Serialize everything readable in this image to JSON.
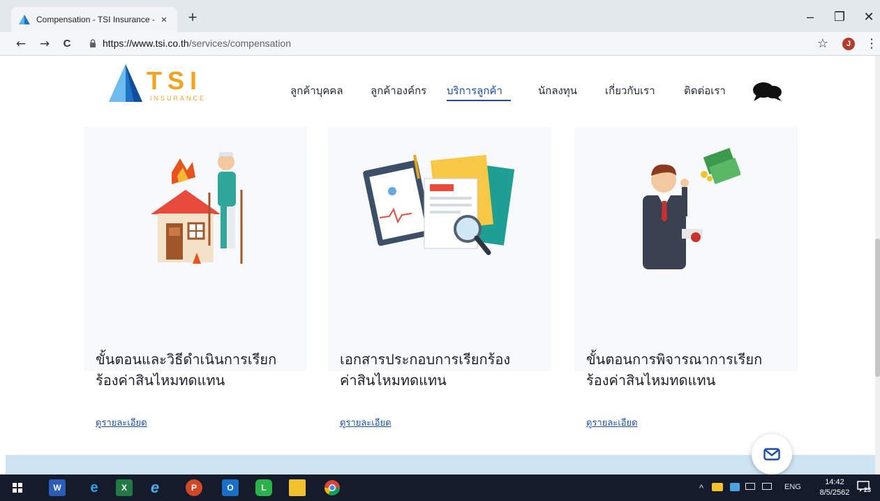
{
  "browser": {
    "tab_title": "Compensation - TSI Insurance -",
    "tab_close": "×",
    "new_tab": "+",
    "window_controls": {
      "minimize": "–",
      "maximize": "❐",
      "close": "✕"
    },
    "nav": {
      "back": "←",
      "forward": "→",
      "reload": "C"
    },
    "url_host": "https://www.tsi.co.th",
    "url_path": "/services/compensation",
    "bookmark_icon": "☆",
    "profile_initial": "J",
    "menu_icon": "⋮"
  },
  "site": {
    "logo_text": "TSI",
    "logo_subtext": "INSURANCE",
    "nav_items": [
      {
        "label": "ลูกค้าบุคคล"
      },
      {
        "label": "ลูกค้าองค์กร"
      },
      {
        "label": "บริการลูกค้า",
        "active": true
      },
      {
        "label": "นักลงทุน"
      },
      {
        "label": "เกี่ยวกับเรา"
      },
      {
        "label": "ติดต่อเรา"
      }
    ],
    "chat_icon": "chat-bubbles-icon"
  },
  "cards": [
    {
      "title_line1": "ขั้นตอนและวิธีดำเนินการเรียก",
      "title_line2": "ร้องค่าสินไหมทดแทน",
      "link": "ดูรายละเอียด",
      "illustration": "house-fire-injured-person-illustration"
    },
    {
      "title_line1": "เอกสารประกอบการเรียกร้อง",
      "title_line2": "ค่าสินไหมทดแทน",
      "link": "ดูรายละเอียด",
      "illustration": "documents-clipboard-magnifier-illustration"
    },
    {
      "title_line1": "ขั้นตอนการพิจารณาการเรียก",
      "title_line2": "ร้องค่าสินไหมทดแทน",
      "link": "ดูรายละเอียด",
      "illustration": "businessman-money-illustration"
    }
  ],
  "mail_button_icon": "mail-icon",
  "taskbar": {
    "tray_language": "ENG",
    "tray_chevron": "^",
    "time": "14:42",
    "date": "8/5/2562",
    "notification_count": "23"
  },
  "colors": {
    "brand_blue": "#1b4ca8",
    "logo_orange": "#f2a31d",
    "card_bg": "#f8f9fb",
    "footer_band": "#cfe4f2",
    "taskbar": "#141b2b"
  }
}
